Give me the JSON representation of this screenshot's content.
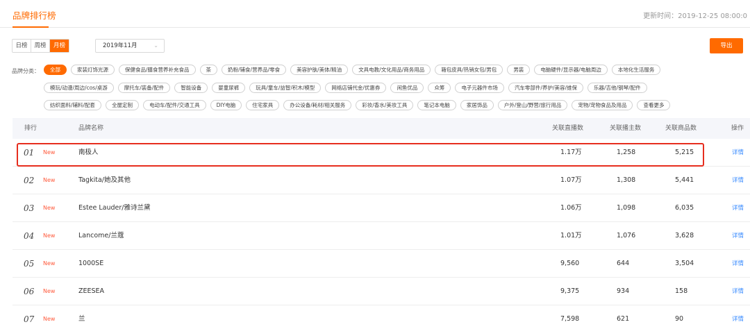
{
  "header": {
    "title": "品牌排行榜",
    "updated": "更新时间：2019-12-25 08:00:0"
  },
  "controls": {
    "tabs": [
      "日榜",
      "周榜",
      "月榜"
    ],
    "active_tab": "月榜",
    "month_value": "2019年11月",
    "export_label": "导出"
  },
  "categories": {
    "label": "品牌分类：",
    "rows": [
      [
        "全部",
        "家装灯饰光源",
        "保健食品/膳食营养补充食品",
        "茶",
        "奶粉/辅食/营养品/零食",
        "美容护肤/美体/精油",
        "文具电教/文化用品/商务用品",
        "箱包皮具/热销女包/男包",
        "男装",
        "电脑硬件/显示器/电脑周边",
        "本地化生活服务"
      ],
      [
        "模玩/动漫/周边/cos/桌游",
        "摩托车/装备/配件",
        "智能设备",
        "婴童尿裤",
        "玩具/童车/益智/积木/模型",
        "网络店铺代金/优惠券",
        "闲鱼优品",
        "众筹",
        "电子元器件市场",
        "汽车零部件/养护/美容/维保",
        "乐器/吉他/钢琴/配件"
      ],
      [
        "纺织面料/辅料/配套",
        "全屋定制",
        "电动车/配件/交通工具",
        "DIY电脑",
        "住宅家具",
        "办公设备/耗材/相关服务",
        "彩妆/香水/美妆工具",
        "笔记本电脑",
        "家居饰品",
        "户外/登山/野营/旅行用品",
        "宠物/宠物食品及用品",
        "查看更多"
      ]
    ],
    "active": "全部"
  },
  "table": {
    "columns": {
      "rank": "排行",
      "brand": "品牌名称",
      "live": "关联直播数",
      "anchors": "关联播主数",
      "products": "关联商品数",
      "action": "操作"
    },
    "rows": [
      {
        "rank": "01",
        "badge": "New",
        "brand": "南极人",
        "live": "1.17万",
        "anchors": "1,258",
        "products": "5,215",
        "action": "详情"
      },
      {
        "rank": "02",
        "badge": "New",
        "brand": "Tagkita/她及其他",
        "live": "1.07万",
        "anchors": "1,308",
        "products": "5,441",
        "action": "详情"
      },
      {
        "rank": "03",
        "badge": "New",
        "brand": "Estee Lauder/雅诗兰黛",
        "live": "1.06万",
        "anchors": "1,098",
        "products": "6,035",
        "action": "详情"
      },
      {
        "rank": "04",
        "badge": "New",
        "brand": "Lancome/兰蔻",
        "live": "1.01万",
        "anchors": "1,076",
        "products": "3,628",
        "action": "详情"
      },
      {
        "rank": "05",
        "badge": "New",
        "brand": "1000SE",
        "live": "9,560",
        "anchors": "644",
        "products": "3,504",
        "action": "详情"
      },
      {
        "rank": "06",
        "badge": "New",
        "brand": "ZEESEA",
        "live": "9,375",
        "anchors": "934",
        "products": "158",
        "action": "详情"
      },
      {
        "rank": "07",
        "badge": "New",
        "brand": "兰",
        "live": "7,598",
        "anchors": "621",
        "products": "90",
        "action": "详情"
      }
    ]
  },
  "colors": {
    "accent": "#ff6a00",
    "new_badge": "#ff5a3c",
    "link": "#3b8cff",
    "highlight_box": "#e62d1e"
  }
}
